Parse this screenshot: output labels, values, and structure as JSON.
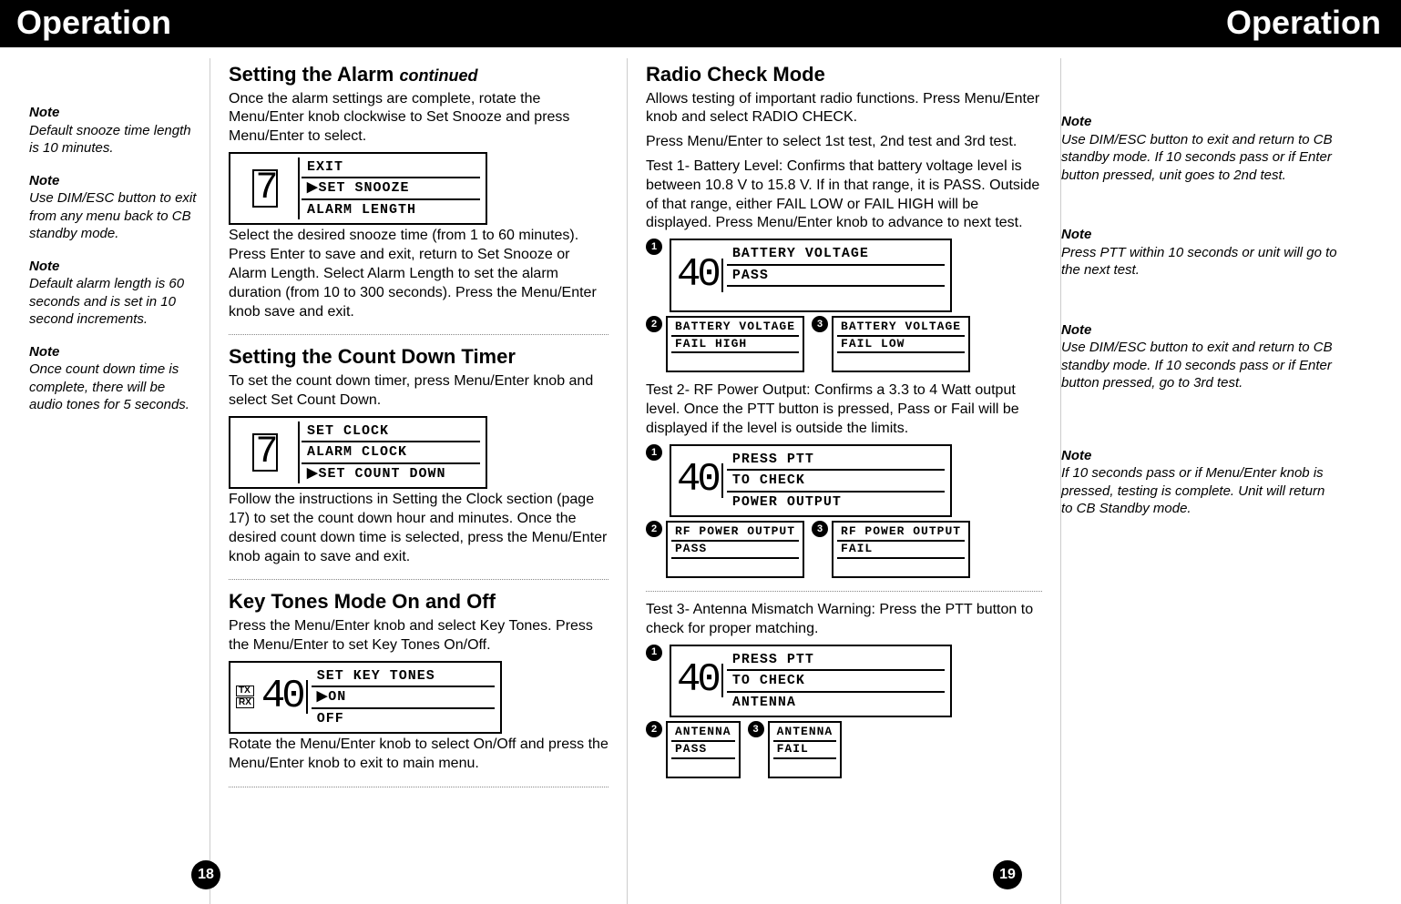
{
  "header": {
    "left": "Operation",
    "right": "Operation"
  },
  "page_numbers": {
    "left": "18",
    "right": "19"
  },
  "left_notes": [
    {
      "label": "Note",
      "text": "Default snooze time length is 10 minutes."
    },
    {
      "label": "Note",
      "text": "Use DIM/ESC button to exit from any menu back to CB standby mode."
    },
    {
      "label": "Note",
      "text": "Default alarm length is 60 seconds and is set in 10 second increments."
    },
    {
      "label": "Note",
      "text": "Once count down time is complete, there will be audio tones for 5 seconds."
    }
  ],
  "right_notes": [
    {
      "label": "Note",
      "text": "Use DIM/ESC button to exit and return to CB standby mode. If 10 seconds pass or if Enter button pressed, unit goes to 2nd test."
    },
    {
      "label": "Note",
      "text": "Press PTT within 10 seconds or unit will go to the next test."
    },
    {
      "label": "Note",
      "text": "Use DIM/ESC button to exit and return to CB standby mode. If 10 seconds pass or if Enter button pressed, go to 3rd test."
    },
    {
      "label": "Note",
      "text": "If 10 seconds pass or if Menu/Enter knob is pressed, testing is complete. Unit will return to CB Standby mode."
    }
  ],
  "col_a": {
    "alarm_title": "Setting the Alarm",
    "alarm_cont": "continued",
    "alarm_p1": "Once the alarm settings are complete, rotate the Menu/Enter knob clockwise to Set Snooze and press Menu/Enter to select.",
    "alarm_lcd": [
      "EXIT",
      "▶SET SNOOZE",
      "ALARM LENGTH"
    ],
    "alarm_p2": "Select the desired snooze time (from 1 to 60 minutes). Press Enter to save and exit, return to Set Snooze or Alarm Length. Select Alarm Length to set the alarm duration (from 10 to 300 seconds). Press the Menu/Enter knob save and exit.",
    "countdown_title": "Setting the Count Down Timer",
    "countdown_p1": "To set the count down timer, press Menu/Enter knob and select Set Count Down.",
    "countdown_lcd": [
      "SET CLOCK",
      "ALARM CLOCK",
      "▶SET COUNT DOWN"
    ],
    "countdown_p2": "Follow the instructions in Setting the Clock section (page 17) to set the count down hour and minutes. Once the desired count down time is selected, press the Menu/Enter knob again to save and exit.",
    "keytones_title": "Key Tones Mode On and Off",
    "keytones_p1": "Press the Menu/Enter knob and select Key Tones. Press the Menu/Enter to set Key Tones On/Off.",
    "keytones_ch": "40",
    "keytones_lcd": [
      "SET KEY TONES",
      "▶ON",
      "OFF"
    ],
    "keytones_p2": "Rotate the Menu/Enter knob to select On/Off and press the Menu/Enter knob to exit to main menu."
  },
  "col_b": {
    "radio_title": "Radio Check Mode",
    "radio_p1": "Allows testing of important radio functions. Press Menu/Enter knob and select RADIO CHECK.",
    "radio_p2": "Press Menu/Enter to select 1st test, 2nd test and 3rd test.",
    "test1_p": "Test 1- Battery Level: Confirms that battery voltage level is between 10.8 V to 15.8 V. If in that range, it is PASS. Outside of that range, either FAIL LOW or FAIL HIGH will be displayed. Press Menu/Enter knob to advance to next test.",
    "test1_lcd_main": {
      "ch": "40",
      "rows": [
        "BATTERY VOLTAGE",
        "PASS"
      ]
    },
    "test1_lcd2": [
      "BATTERY VOLTAGE",
      "FAIL HIGH"
    ],
    "test1_lcd3": [
      "BATTERY VOLTAGE",
      "FAIL LOW"
    ],
    "test2_p": "Test 2- RF Power Output: Confirms a 3.3 to 4 Watt output level. Once the PTT button is pressed, Pass or Fail will be displayed if the level is outside the limits.",
    "test2_lcd_main": {
      "ch": "40",
      "rows": [
        "PRESS PTT",
        "TO CHECK",
        "POWER OUTPUT"
      ]
    },
    "test2_lcd2": [
      "RF POWER OUTPUT",
      "PASS"
    ],
    "test2_lcd3": [
      "RF POWER OUTPUT",
      "FAIL"
    ],
    "test3_p": "Test 3- Antenna Mismatch Warning: Press the PTT button to check for proper matching.",
    "test3_lcd_main": {
      "ch": "40",
      "rows": [
        "PRESS PTT",
        "TO CHECK",
        "ANTENNA"
      ]
    },
    "test3_lcd2": [
      "ANTENNA",
      "PASS"
    ],
    "test3_lcd3": [
      "ANTENNA",
      "FAIL"
    ]
  }
}
